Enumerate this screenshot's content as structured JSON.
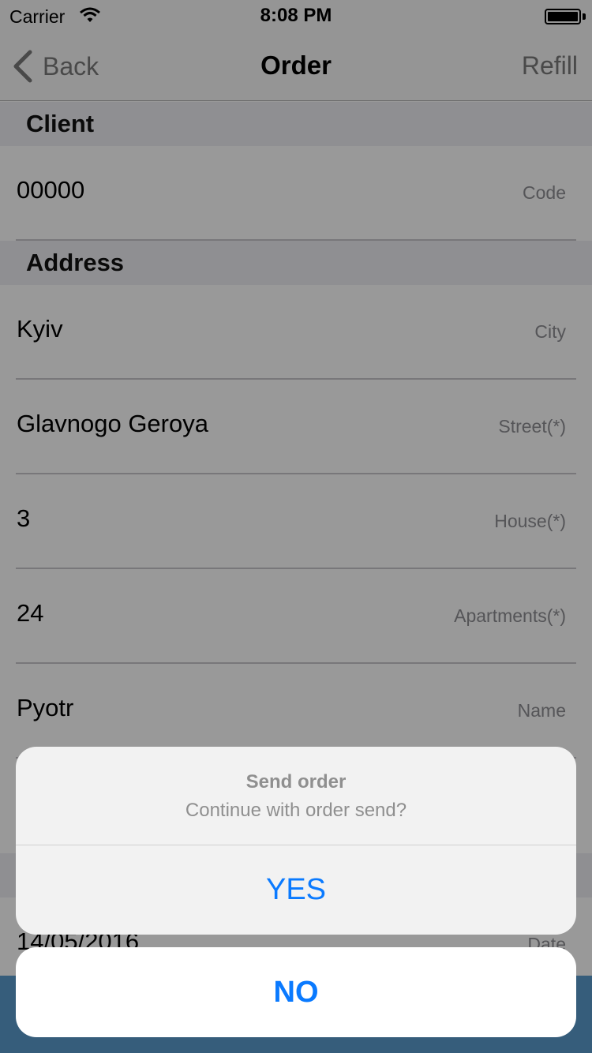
{
  "status_bar": {
    "carrier": "Carrier",
    "time": "8:08 PM"
  },
  "nav": {
    "back_label": "Back",
    "title": "Order",
    "refill_label": "Refill"
  },
  "sections": {
    "client": {
      "title": "Client",
      "rows": [
        {
          "value": "00000",
          "label": "Code"
        }
      ]
    },
    "address": {
      "title": "Address",
      "rows": [
        {
          "value": "Kyiv",
          "label": "City"
        },
        {
          "value": "Glavnogo Geroya",
          "label": "Street(*)"
        },
        {
          "value": "3",
          "label": "House(*)"
        },
        {
          "value": "24",
          "label": "Apartments(*)"
        },
        {
          "value": "Pyotr",
          "label": "Name"
        }
      ]
    },
    "date_row": {
      "value": "14/05/2016",
      "label": "Date"
    }
  },
  "action_sheet": {
    "title": "Send order",
    "message": "Continue with order send?",
    "confirm_label": "YES",
    "cancel_label": "NO"
  },
  "colors": {
    "accent": "#0a7aff",
    "bottom_bar": "#5a9ccd",
    "section_bg": "#efeff4"
  }
}
